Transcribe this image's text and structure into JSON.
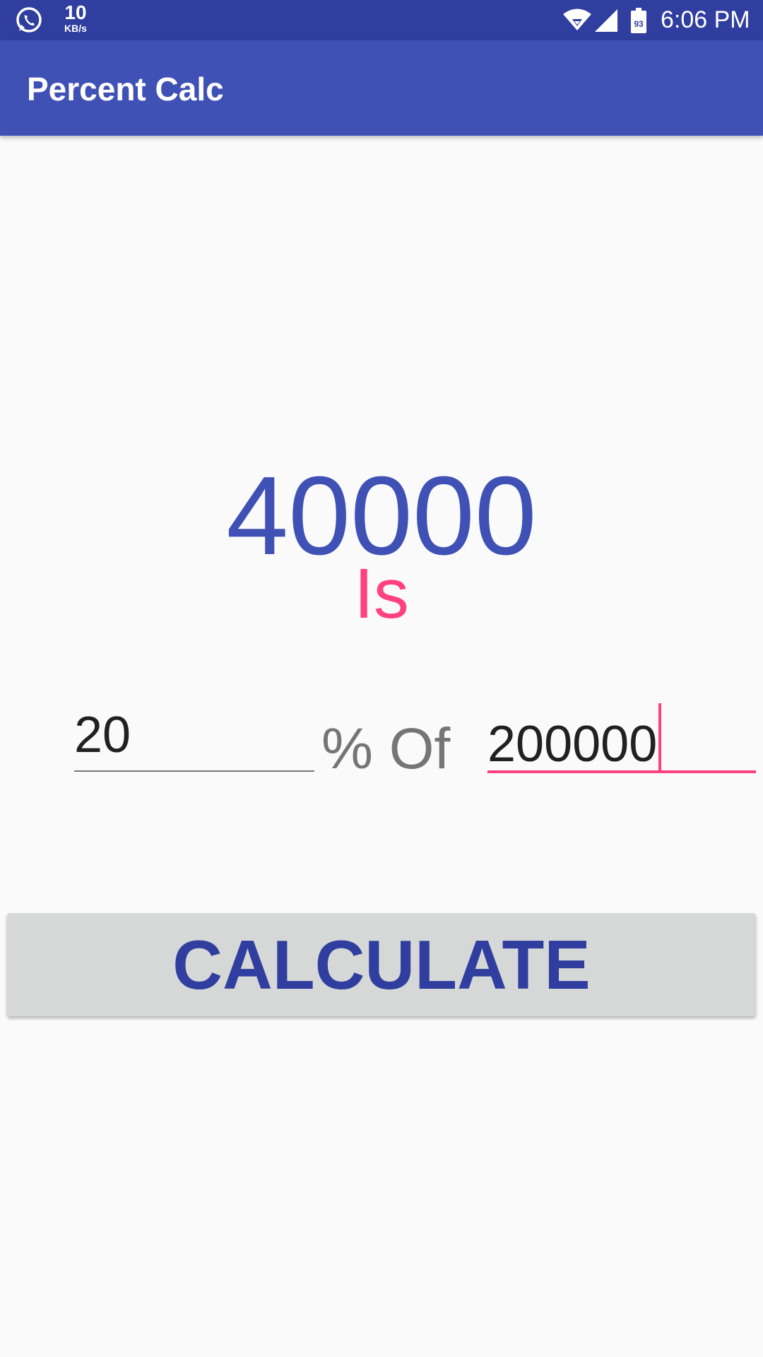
{
  "status_bar": {
    "net_speed_value": "10",
    "net_speed_unit": "KB/s",
    "battery_level": "93",
    "time": "6:06 PM",
    "icons": [
      "whatsapp-icon",
      "wifi-icon",
      "cell-signal-icon",
      "battery-icon"
    ]
  },
  "app_bar": {
    "title": "Percent Calc",
    "color": "#3f51b5"
  },
  "result": {
    "value": "40000",
    "label": "Is",
    "value_color": "#3f51b5",
    "label_color": "#ff4081"
  },
  "form": {
    "percent_value": "20",
    "connector_label": "% Of",
    "base_value": "200000",
    "focused_field": "base"
  },
  "actions": {
    "calculate_label": "CALCULATE"
  },
  "colors": {
    "status_bar": "#303f9f",
    "primary": "#3f51b5",
    "accent": "#ff4081",
    "background": "#fafafa",
    "button_bg": "#d6d7d7"
  }
}
